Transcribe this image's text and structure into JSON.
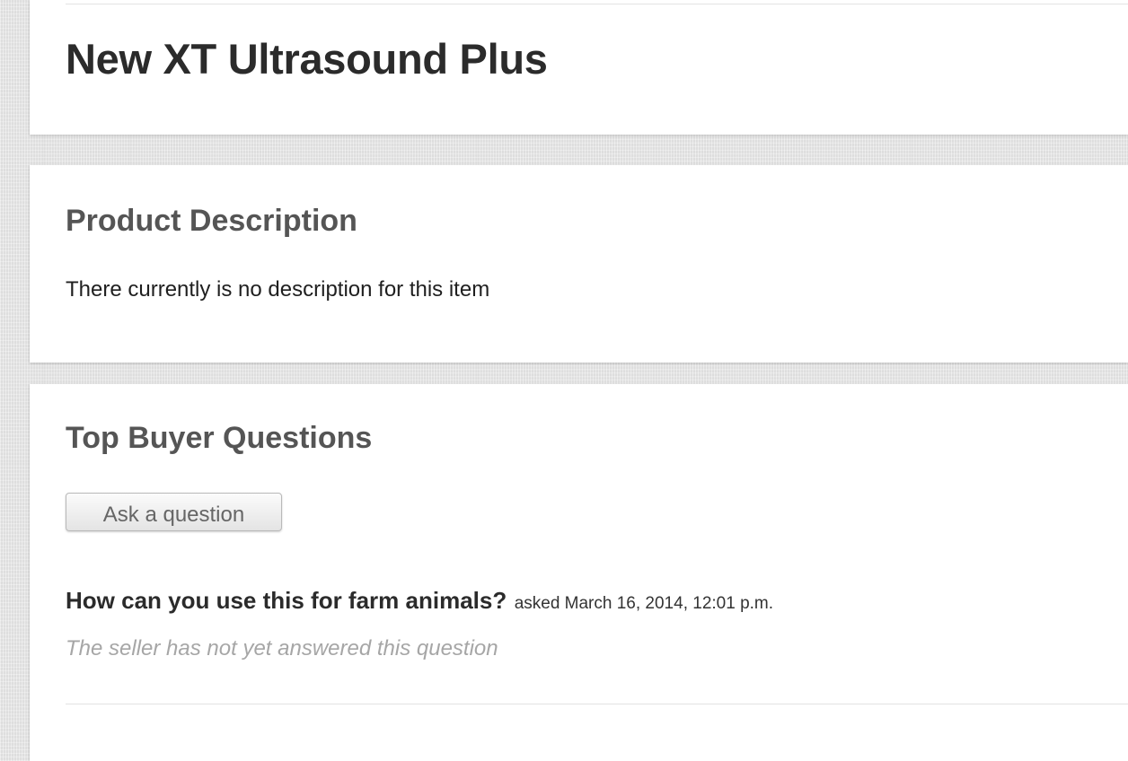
{
  "product": {
    "title": "New XT Ultrasound Plus"
  },
  "description": {
    "heading": "Product Description",
    "text": "There currently is no description for this item"
  },
  "questions": {
    "heading": "Top Buyer Questions",
    "ask_button_label": "Ask a question",
    "items": [
      {
        "question": "How can you use this for farm animals?",
        "asked_label": "asked March 16, 2014, 12:01 p.m.",
        "answer_status": "The seller has not yet answered this question"
      }
    ]
  },
  "colors": {
    "page_background": "#e6e6e6",
    "panel_background": "#ffffff",
    "heading_text": "#555555",
    "title_text": "#2b2b2b",
    "muted_answer_text": "#a6a6a6"
  }
}
